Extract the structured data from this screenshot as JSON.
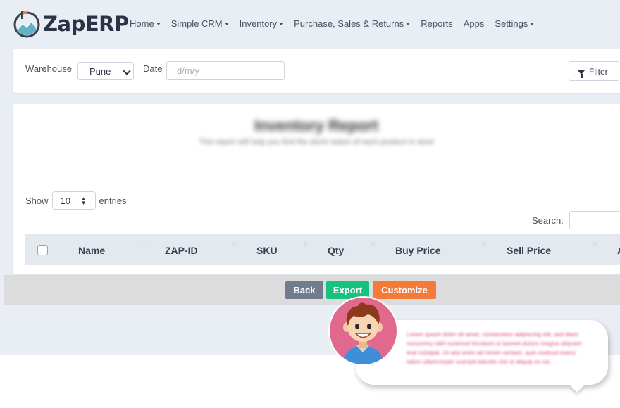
{
  "brand": {
    "name": "ZapERP"
  },
  "nav": [
    {
      "label": "Home",
      "dropdown": true
    },
    {
      "label": "Simple CRM",
      "dropdown": true
    },
    {
      "label": "Inventory",
      "dropdown": true
    },
    {
      "label": "Purchase, Sales & Returns",
      "dropdown": true
    },
    {
      "label": "Reports",
      "dropdown": false
    },
    {
      "label": "Apps",
      "dropdown": false
    },
    {
      "label": "Settings",
      "dropdown": true
    }
  ],
  "filter": {
    "warehouse_label": "Warehouse",
    "warehouse_value": "Pune",
    "date_label": "Date",
    "date_placeholder": "d/m/y",
    "filter_button": "Filter"
  },
  "report": {
    "title": "Inventory Report",
    "subtitle": "This report will help you find the stock status of each product in store",
    "show_label": "Show",
    "entries_value": "10",
    "entries_label": "entries",
    "search_label": "Search:",
    "columns": [
      "Name",
      "ZAP-ID",
      "SKU",
      "Qty",
      "Buy Price",
      "Sell Price",
      "A"
    ]
  },
  "actions": {
    "back": "Back",
    "export": "Export",
    "customize": "Customize"
  },
  "assistant": {
    "message": "Lorem ipsum dolor sit amet, consectetur adipiscing elit, sed diam nonummy nibh euismod tincidunt ut laoreet dolore magna aliquam erat volutpat. Ut wisi enim ad minim veniam, quis nostrud exerci tation ullamcorper suscipit lobortis nisl ut aliquip ex ea."
  },
  "colors": {
    "export": "#16c27d",
    "customize": "#f47a37",
    "back": "#717d8e",
    "avatar_bg": "#e2698e"
  }
}
